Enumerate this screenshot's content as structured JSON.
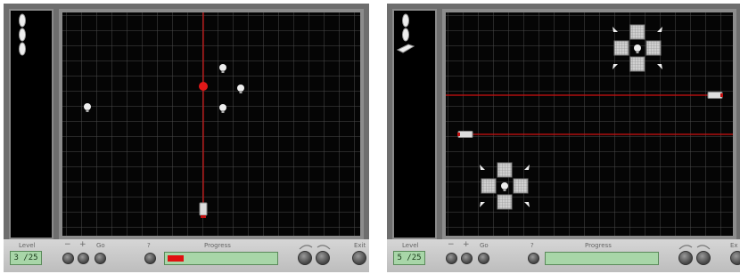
{
  "panels": [
    {
      "labels": {
        "level": "Level",
        "minus": "−",
        "plus": "+",
        "go": "Go",
        "help": "?",
        "progress": "Progress",
        "exit": "Exit"
      },
      "level_value": "3 /25",
      "progress": 0.15,
      "colors": {
        "laser": "#d01010",
        "board": "#050505",
        "progress_fill": "#e01010"
      }
    },
    {
      "labels": {
        "level": "Level",
        "minus": "−",
        "plus": "+",
        "go": "Go",
        "help": "?",
        "progress": "Progress",
        "exit": "Ex"
      },
      "level_value": "5 /25",
      "progress": 0.0,
      "colors": {
        "laser": "#d01010"
      }
    }
  ]
}
